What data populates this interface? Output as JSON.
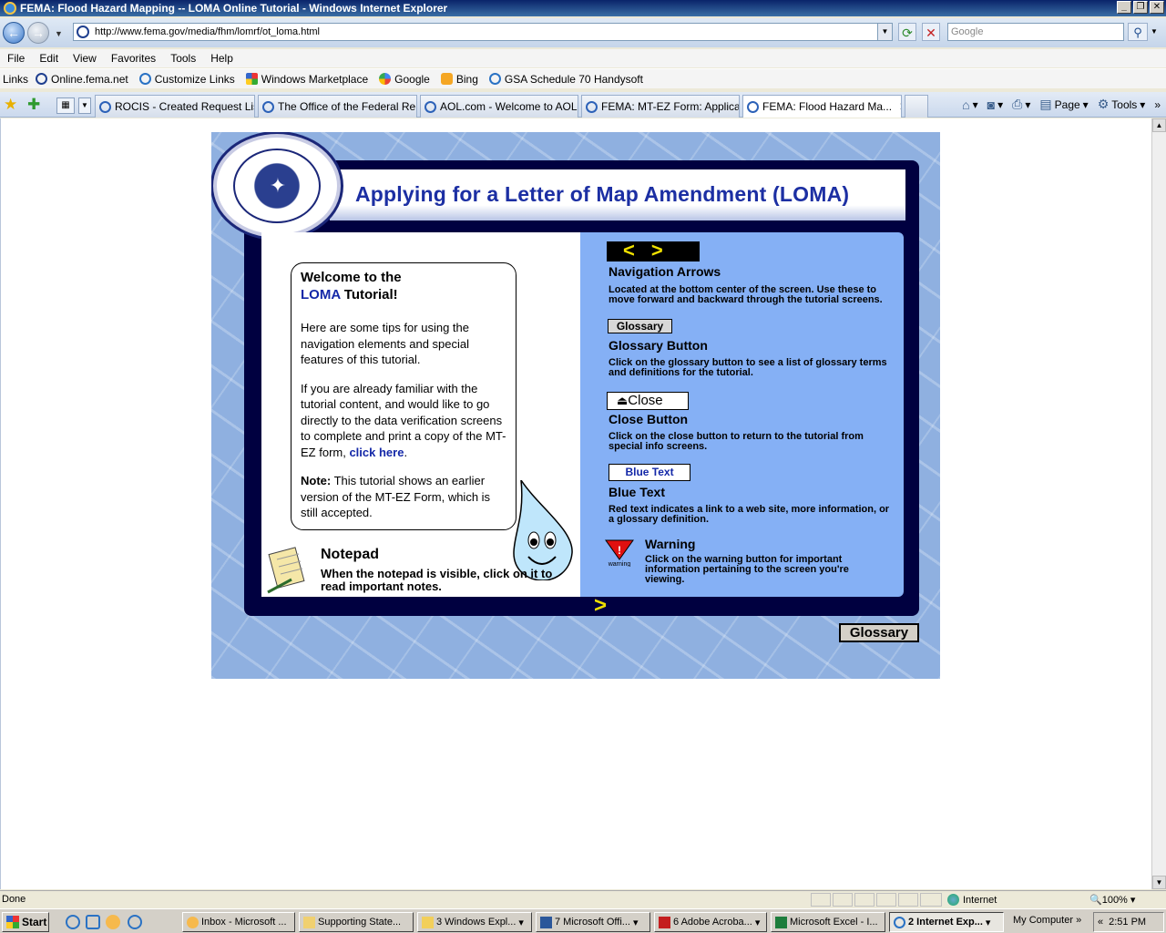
{
  "window": {
    "title": "FEMA: Flood Hazard Mapping -- LOMA Online Tutorial - Windows Internet Explorer",
    "controls": [
      "_",
      "❐",
      "✕"
    ]
  },
  "address": {
    "url": "http://www.fema.gov/media/fhm/lomrf/ot_loma.html",
    "search_placeholder": "Google"
  },
  "menu": [
    "File",
    "Edit",
    "View",
    "Favorites",
    "Tools",
    "Help"
  ],
  "links": {
    "label": "Links",
    "items": [
      "Online.fema.net",
      "Customize Links",
      "Windows Marketplace",
      "Google",
      "Bing",
      "GSA Schedule 70  Handysoft"
    ]
  },
  "tabs": [
    {
      "label": "ROCIS - Created Request List"
    },
    {
      "label": "The Office of the Federal Re..."
    },
    {
      "label": "AOL.com - Welcome to AOL"
    },
    {
      "label": "FEMA: MT-EZ Form: Applicat..."
    },
    {
      "label": "FEMA: Flood Hazard Ma..."
    }
  ],
  "toolbar_right": {
    "page": "Page",
    "tools": "Tools"
  },
  "tutorial": {
    "title": "Applying for a Letter of Map Amendment (LOMA)",
    "welcome_line1": "Welcome to the",
    "welcome_loma": "LOMA",
    "welcome_line2_rest": " Tutorial!",
    "tips": "Here are some tips for using the navigation elements and special features of this tutorial.",
    "familiar": "If you are already familiar with the tutorial content, and would like to go directly to the data verification screens to complete and print a copy of the MT-EZ form, ",
    "click_here": "click here",
    "period": ".",
    "note_label": "Note:",
    "note_text": " This tutorial shows an earlier version of the MT-EZ Form, which is still accepted.",
    "notepad_title": "Notepad",
    "notepad_desc": "When the notepad is visible, click on it to read important notes.",
    "nav_arrows_title": "Navigation Arrows",
    "nav_arrows_desc": "Located at the bottom center of the screen. Use these to move forward and backward through the tutorial screens.",
    "sample_glossary": "Glossary",
    "glossary_title": "Glossary Button",
    "glossary_desc": "Click on the glossary button to see a list of glossary terms and definitions for the tutorial.",
    "sample_close": "Close",
    "close_title": "Close Button",
    "close_desc": "Click on the close button to return to the tutorial from special info screens.",
    "sample_blue": "Blue Text",
    "blue_title": "Blue Text",
    "blue_desc": "Red text indicates a link to a web site, more information, or a glossary definition.",
    "warning_icon_label": "warning",
    "warning_title": "Warning",
    "warning_desc": "Click on the warning button for important information pertaining to the screen you're viewing.",
    "glossary_button": "Glossary",
    "next_arrow": ">",
    "prev_arrow_sample": "<",
    "next_arrow_sample": ">"
  },
  "status": {
    "text": "Done",
    "zone": "Internet",
    "zoom": "100%"
  },
  "taskbar": {
    "start": "Start",
    "items": [
      "Inbox - Microsoft ...",
      "Supporting State...",
      "3 Windows Expl...",
      "7 Microsoft Offi...",
      "6 Adobe Acroba...",
      "Microsoft Excel - I...",
      "2 Internet Exp..."
    ],
    "my_computer": "My Computer",
    "clock": "2:51 PM"
  },
  "colors": {
    "title_blue": "#1c2fa3",
    "panel_blue": "#85b0f5",
    "frame_navy": "#000040",
    "arrow_yellow": "#f0e000"
  }
}
